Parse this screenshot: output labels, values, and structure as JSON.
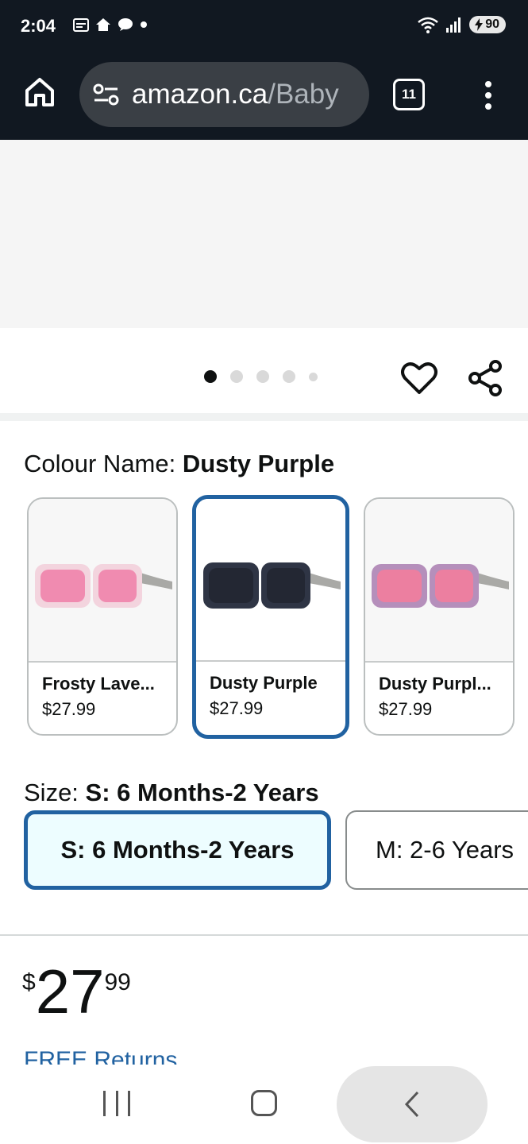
{
  "status_bar": {
    "time": "2:04",
    "battery": "90"
  },
  "browser": {
    "url_host": "amazon.ca",
    "url_path": "/Baby",
    "tab_count": "11"
  },
  "gallery": {
    "dot_count": 5,
    "active_dot": 0
  },
  "colour": {
    "label": "Colour Name: ",
    "selected": "Dusty Purple",
    "swatches": [
      {
        "name": "Frosty Lave...",
        "price": "$27.99",
        "frame_color": "#f3d4de",
        "lens_color": "#f08bb0"
      },
      {
        "name": "Dusty Purple",
        "price": "$27.99",
        "frame_color": "#2f3545",
        "lens_color": "#232733"
      },
      {
        "name": "Dusty Purpl...",
        "price": "$27.99",
        "frame_color": "#b58fbb",
        "lens_color": "#ec7fa0"
      }
    ]
  },
  "size": {
    "label": "Size: ",
    "selected": "S: 6 Months-2 Years",
    "options": [
      "S: 6 Months-2 Years",
      "M: 2-6 Years"
    ]
  },
  "price": {
    "symbol": "$",
    "whole": "27",
    "fraction": "99"
  },
  "free_returns": "FREE Returns",
  "colors": {
    "selected_border": "#2162a1",
    "link": "#2162a1"
  }
}
